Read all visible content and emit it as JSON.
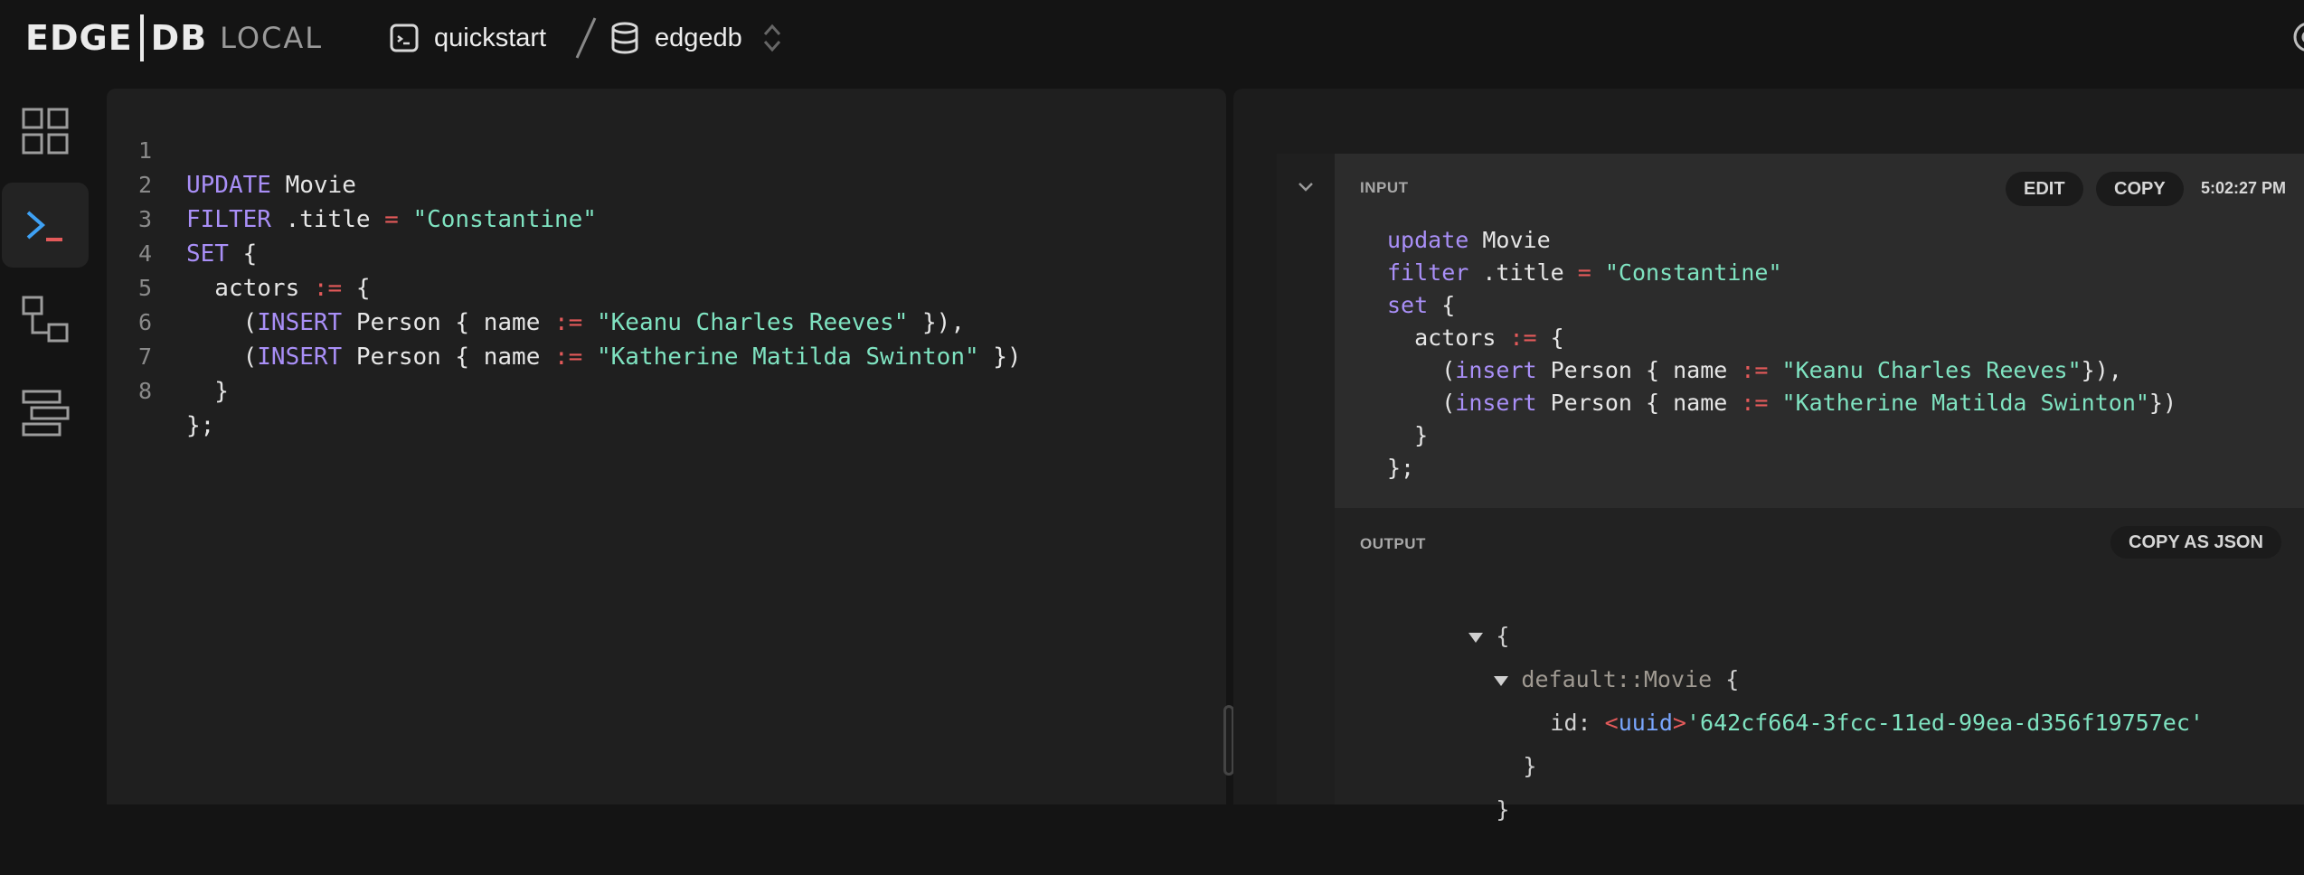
{
  "header": {
    "logo_edge": "EDGE",
    "logo_db": "DB",
    "logo_local": "LOCAL",
    "instance": "quickstart",
    "database": "edgedb"
  },
  "sidebar": {
    "items": [
      {
        "name": "dashboard",
        "icon": "grid-icon"
      },
      {
        "name": "repl",
        "icon": "terminal-icon",
        "active": true
      },
      {
        "name": "schema",
        "icon": "schema-icon"
      },
      {
        "name": "data",
        "icon": "data-explorer-icon"
      }
    ]
  },
  "editor": {
    "line_numbers": [
      "1",
      "2",
      "3",
      "4",
      "5",
      "6",
      "7",
      "8"
    ],
    "tokens": {
      "l1": [
        "UPDATE",
        " Movie"
      ],
      "l2": [
        "FILTER",
        " .title ",
        "=",
        " ",
        "\"Constantine\""
      ],
      "l3": [
        "SET",
        " {"
      ],
      "l4": [
        "  actors ",
        ":=",
        " {"
      ],
      "l5": [
        "    (",
        "INSERT",
        " Person { name ",
        ":=",
        " ",
        "\"Keanu Charles Reeves\"",
        " }),"
      ],
      "l6": [
        "    (",
        "INSERT",
        " Person { name ",
        ":=",
        " ",
        "\"Katherine Matilda Swinton\"",
        " })"
      ],
      "l7": [
        "  }"
      ],
      "l8": [
        "};"
      ]
    }
  },
  "history": {
    "input_label": "INPUT",
    "edit_label": "EDIT",
    "copy_label": "COPY",
    "timestamp": "5:02:27 PM",
    "input_tokens": {
      "r1": [
        "update",
        " Movie"
      ],
      "r2": [
        "filter",
        " .title ",
        "=",
        " ",
        "\"Constantine\""
      ],
      "r3": [
        "set",
        " {"
      ],
      "r4": [
        "  actors ",
        ":=",
        " {"
      ],
      "r5": [
        "    (",
        "insert",
        " Person { name ",
        ":=",
        " ",
        "\"Keanu Charles Reeves\"",
        "}),"
      ],
      "r6": [
        "    (",
        "insert",
        " Person { name ",
        ":=",
        " ",
        "\"Katherine Matilda Swinton\"",
        "})"
      ],
      "r7": [
        "  }"
      ],
      "r8": [
        "};"
      ]
    },
    "output_label": "OUTPUT",
    "copy_json_label": "COPY AS JSON",
    "output": {
      "open_brace": "{",
      "object_type": "default::Movie",
      "object_open": " {",
      "id_key": "id: ",
      "cast_open": "<",
      "cast_type": "uuid",
      "cast_close": ">",
      "id_value": "'642cf664-3fcc-11ed-99ea-d356f19757ec'",
      "object_close": "}",
      "close_brace": "}"
    }
  },
  "colors": {
    "keyword": "#a98ff7",
    "operator": "#e45a5a",
    "string": "#7fe3c1",
    "type": "#7aa7ff"
  }
}
